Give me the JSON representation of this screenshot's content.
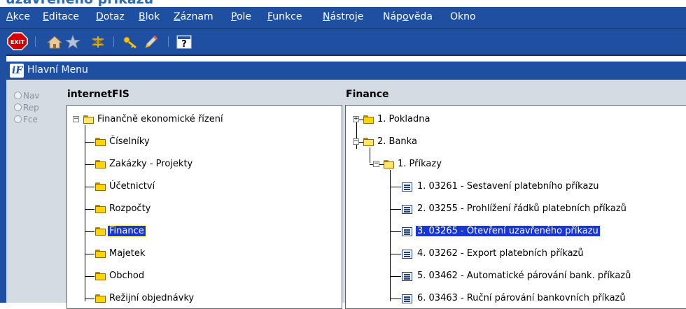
{
  "page_title": "uzavřeného příkazu",
  "menu": [
    {
      "pre": "",
      "u": "A",
      "post": "kce"
    },
    {
      "pre": "",
      "u": "E",
      "post": "ditace"
    },
    {
      "pre": "",
      "u": "D",
      "post": "otaz"
    },
    {
      "pre": "",
      "u": "B",
      "post": "lok"
    },
    {
      "pre": "",
      "u": "Z",
      "post": "áznam"
    },
    {
      "pre": "",
      "u": "P",
      "post": "ole"
    },
    {
      "pre": "",
      "u": "F",
      "post": "unkce"
    },
    {
      "pre": "",
      "u": "N",
      "post": "ástroje"
    },
    {
      "pre": "Náp",
      "u": "o",
      "post": "věda"
    },
    {
      "pre": "Okno",
      "u": "",
      "post": ""
    }
  ],
  "toolbar": {
    "exit_label": "EXIT",
    "icons": [
      "exit-icon",
      "home-icon",
      "star-icon",
      "network-icon",
      "key-icon",
      "pencil-icon",
      "help-icon"
    ]
  },
  "window": {
    "title": "Hlavní Menu",
    "logo": "iF"
  },
  "radio": [
    {
      "label": "Nav"
    },
    {
      "label": "Rep"
    },
    {
      "label": "Fce"
    }
  ],
  "left_panel": {
    "heading": "internetFIS",
    "root": "Finančně ekonomické řízení",
    "items": [
      "Číselníky",
      "Zakázky - Projekty",
      "Účetnictví",
      "Rozpočty",
      "Finance",
      "Majetek",
      "Obchod",
      "Režijní objednávky"
    ],
    "selected": "Finance"
  },
  "right_panel": {
    "heading": "Finance",
    "nodes": [
      {
        "label": "1. Pokladna"
      },
      {
        "label": "2. Banka"
      },
      {
        "label": "1. Příkazy"
      },
      {
        "label": "1. 03261 - Sestavení platebního příkazu"
      },
      {
        "label": "2. 03255 - Prohlížení řádků platebních příkazů"
      },
      {
        "label": "3. 03265 - Otevření uzavřeného příkazu"
      },
      {
        "label": "4. 03262 - Export platebních příkazů"
      },
      {
        "label": "5. 03462 - Automatické párování bank. příkazů"
      },
      {
        "label": "6. 03463 - Ruční párování bankovních příkazů"
      }
    ],
    "selected": "3. 03265 - Otevření uzavřeného příkazu"
  },
  "colors": {
    "chrome": "#1f4fa0",
    "selection": "#1836d6",
    "folder": "#ffd400"
  }
}
